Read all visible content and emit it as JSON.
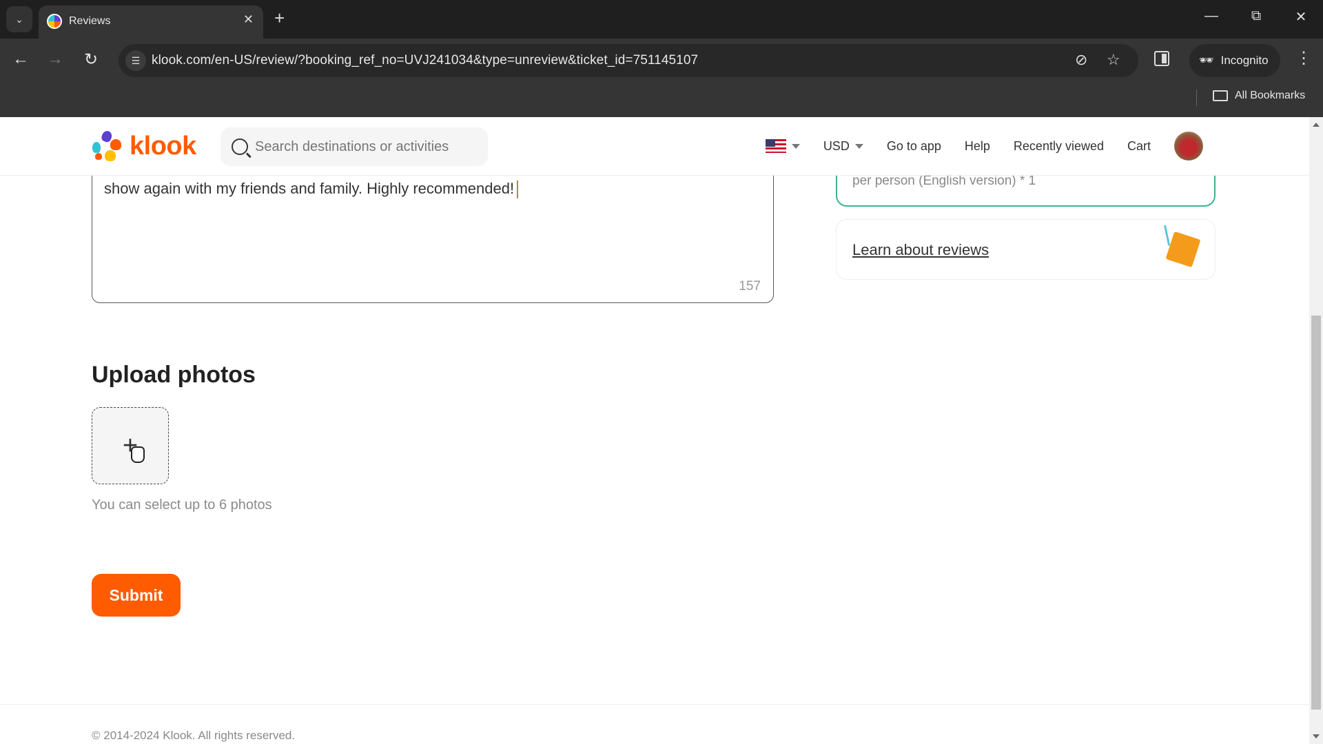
{
  "browser": {
    "tab_title": "Reviews",
    "new_tab_symbol": "+",
    "url": "klook.com/en-US/review/?booking_ref_no=UVJ241034&type=unreview&ticket_id=751145107",
    "incognito_label": "Incognito",
    "all_bookmarks_label": "All Bookmarks"
  },
  "header": {
    "logo_text": "klook",
    "search_placeholder": "Search destinations or activities",
    "currency": "USD",
    "nav_links": [
      "Go to app",
      "Help",
      "Recently viewed",
      "Cart"
    ]
  },
  "review": {
    "text": "The show was so realistic and amazing. Their staffs are very kind and helpful. I hope to see this show again with my friends and family. Highly recommended!",
    "char_count": "157"
  },
  "sidebar": {
    "package_text": "per person (English version) * 1",
    "learn_link": "Learn about reviews"
  },
  "upload": {
    "title": "Upload photos",
    "hint": "You can select up to 6 photos",
    "add_symbol": "+"
  },
  "submit_label": "Submit",
  "footer": {
    "copyright": "© 2014-2024 Klook. All rights reserved."
  },
  "colors": {
    "brand_orange": "#ff5b00",
    "selected_card_border": "#3fb08f"
  }
}
